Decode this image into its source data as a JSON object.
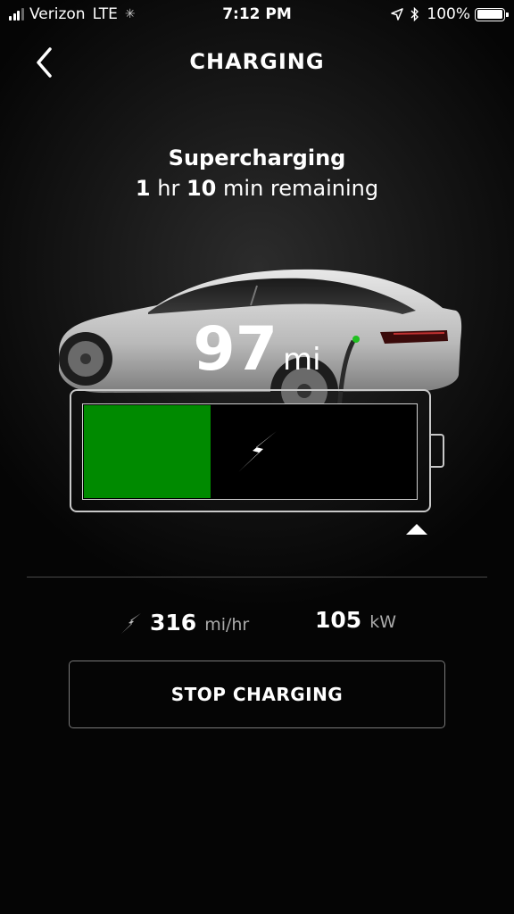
{
  "status_bar": {
    "carrier": "Verizon",
    "network": "LTE",
    "time": "7:12 PM",
    "battery_percent": "100%",
    "battery_level": 1.0
  },
  "header": {
    "title": "CHARGING",
    "back_icon": "chevron-left-icon"
  },
  "charging": {
    "type": "Supercharging",
    "remaining": {
      "hours": "1",
      "hours_unit": "hr",
      "minutes": "10",
      "minutes_unit": "min remaining"
    },
    "range_value": "97",
    "range_unit": "mi",
    "battery_fill_fraction": 0.38,
    "fill_color": "#008a00",
    "bolt_icon": "lightning-bolt-icon",
    "limit_marker_icon": "triangle-up-icon"
  },
  "stats": {
    "rate_icon": "lightning-bolt-icon",
    "rate_value": "316",
    "rate_unit": "mi/hr",
    "power_value": "105",
    "power_unit": "kW"
  },
  "actions": {
    "stop_label": "STOP CHARGING"
  }
}
